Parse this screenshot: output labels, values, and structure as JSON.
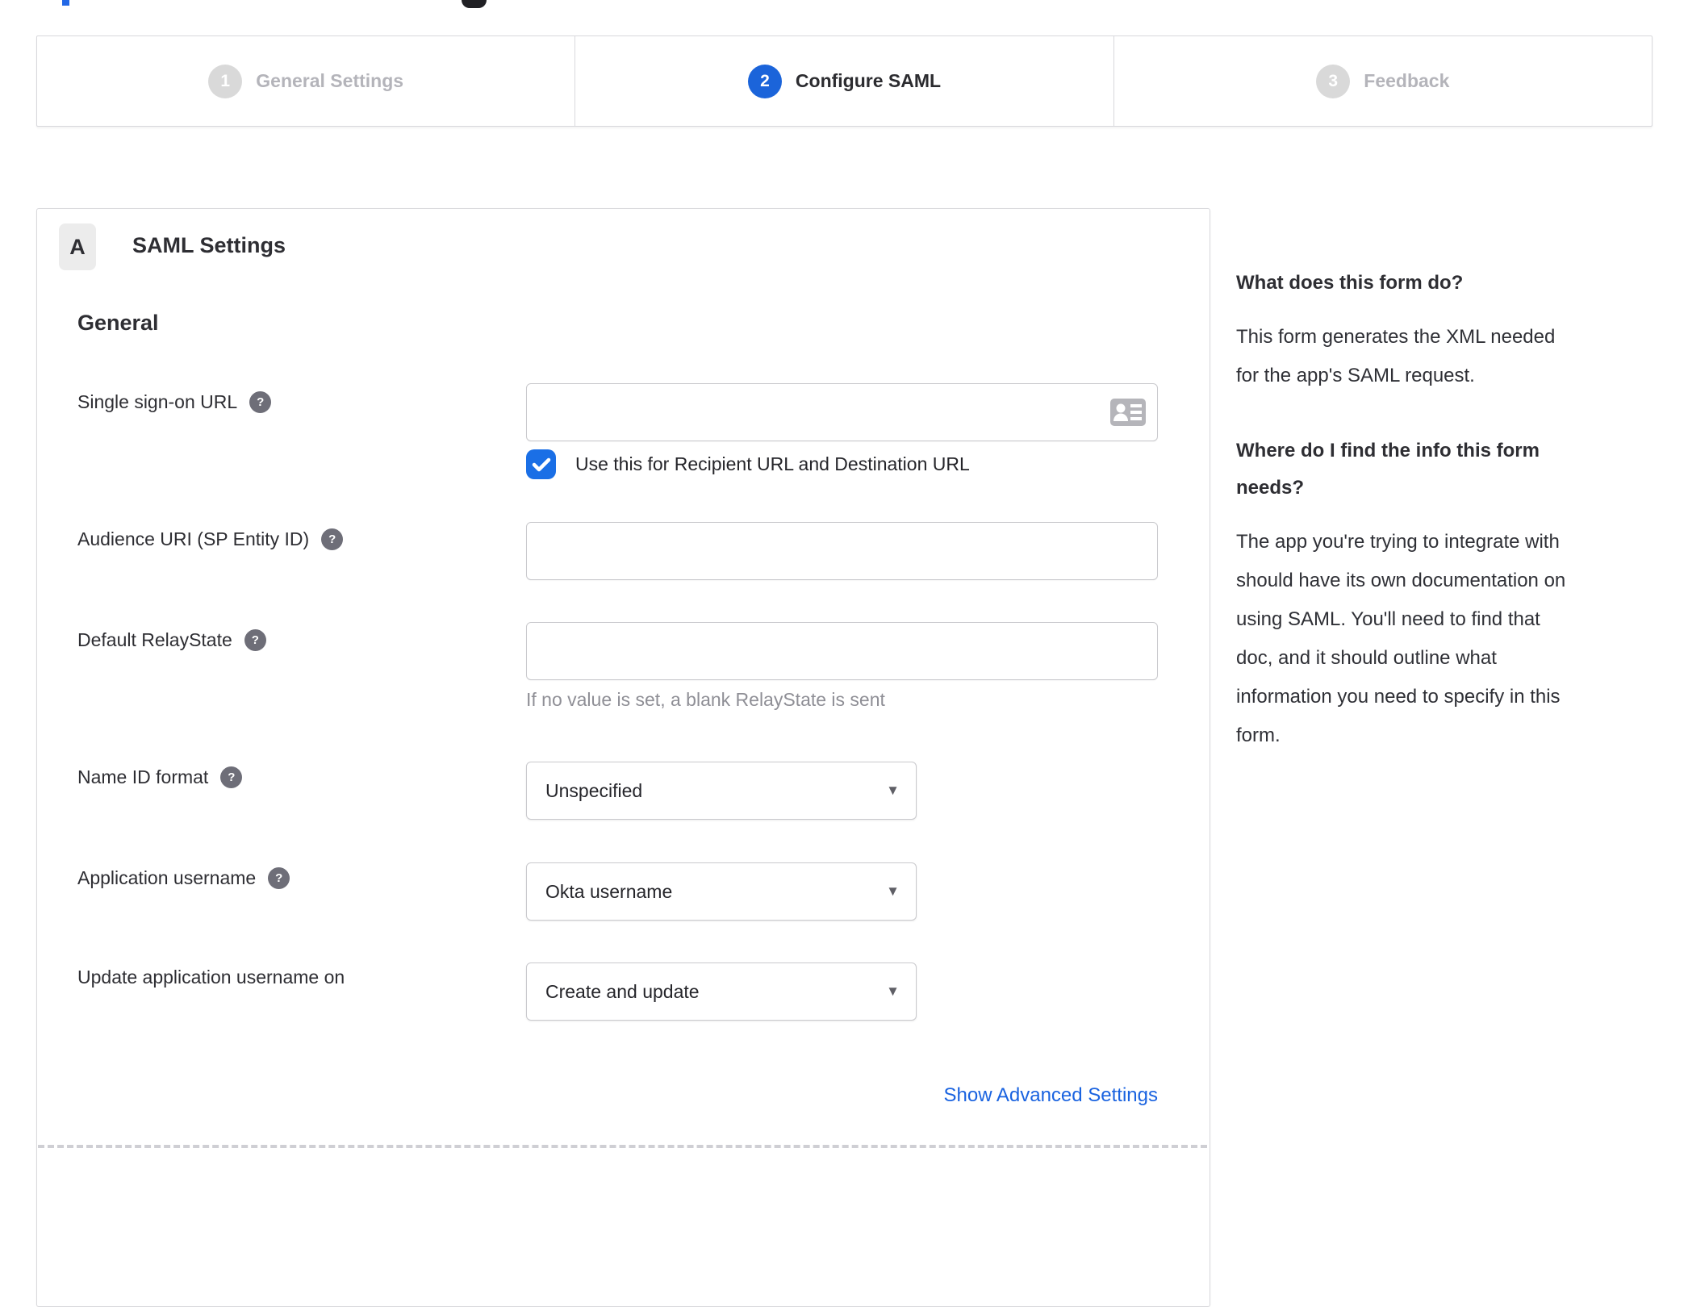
{
  "top_remnants": {
    "note_blue": "cut-off-blue-element",
    "note_dark": "cut-off-dark-rounded-element"
  },
  "stepper": {
    "steps": [
      {
        "number": "1",
        "label": "General Settings",
        "active": false
      },
      {
        "number": "2",
        "label": "Configure SAML",
        "active": true
      },
      {
        "number": "3",
        "label": "Feedback",
        "active": false
      }
    ]
  },
  "form": {
    "section_letter": "A",
    "section_title": "SAML Settings",
    "group_title": "General",
    "sso": {
      "label": "Single sign-on URL",
      "value": "",
      "checkbox_label": "Use this for Recipient URL and Destination URL",
      "checkbox_checked": true
    },
    "audience": {
      "label": "Audience URI (SP Entity ID)",
      "value": ""
    },
    "relay": {
      "label": "Default RelayState",
      "value": "",
      "hint": "If no value is set, a blank RelayState is sent"
    },
    "name_id": {
      "label": "Name ID format",
      "value": "Unspecified"
    },
    "app_username": {
      "label": "Application username",
      "value": "Okta username"
    },
    "update_username": {
      "label": "Update application username on",
      "value": "Create and update"
    },
    "advanced_link": "Show Advanced Settings"
  },
  "sidebar": {
    "sections": [
      {
        "title": "What does this form do?",
        "body": "This form generates the XML needed\nfor the app's SAML request."
      },
      {
        "title": "Where do I find the info this form\nneeds?",
        "body": "The app you're trying to integrate with\nshould have its own documentation on\nusing SAML. You'll need to find that\ndoc, and it should outline what\ninformation you need to specify in this\nform."
      }
    ]
  },
  "icons": {
    "help_icon": "?",
    "dropdown_caret": "▼",
    "checkbox_check": "check",
    "contact_card_icon": "contact-card"
  },
  "colors": {
    "accent_blue": "#1b64da",
    "checkbox_blue": "#1a6fe6",
    "link_blue": "#1a63e0",
    "step_inactive_circle": "#d9d9d9",
    "step_inactive_text": "#b4b4ba",
    "text_dark": "#2e2e33",
    "hint_gray": "#8f8f96",
    "border_gray": "#d8d8dc",
    "badge_bg": "#ececec",
    "help_icon_gray": "#6e6e78"
  }
}
